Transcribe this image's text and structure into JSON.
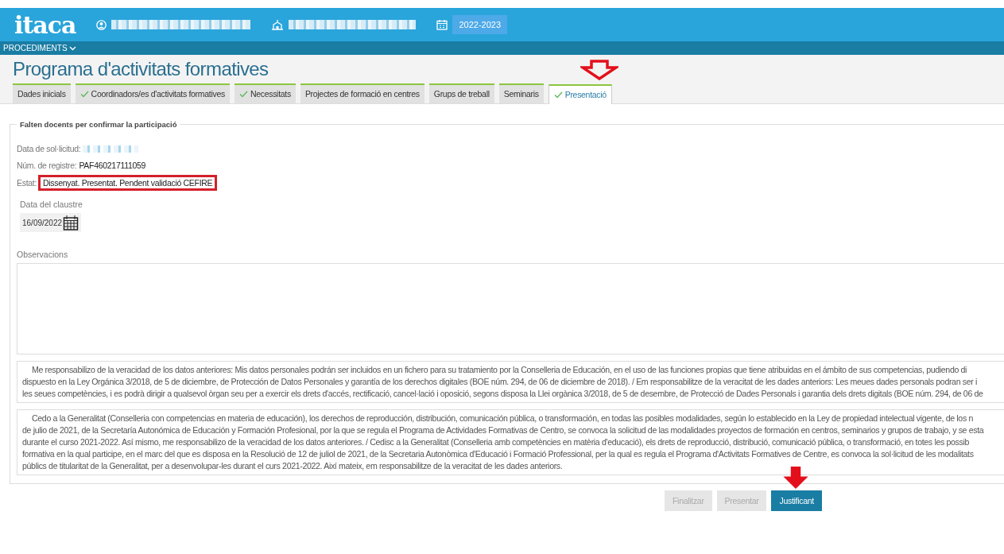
{
  "header": {
    "logo": "itaca",
    "school_year": "2022-2023"
  },
  "menu": {
    "label": "PROCEDIMENTS"
  },
  "page_title": "Programa d'activitats formatives",
  "tabs": [
    {
      "label": "Dades inicials",
      "checked": false,
      "selected": false
    },
    {
      "label": "Coordinadors/es d'activitats formatives",
      "checked": true,
      "selected": false
    },
    {
      "label": "Necessitats",
      "checked": true,
      "selected": false
    },
    {
      "label": "Projectes de formació en centres",
      "checked": false,
      "selected": false
    },
    {
      "label": "Grups de treball",
      "checked": false,
      "selected": false
    },
    {
      "label": "Seminaris",
      "checked": false,
      "selected": false
    },
    {
      "label": "Presentació",
      "checked": true,
      "selected": true
    }
  ],
  "fieldset_legend": "Falten docents per confirmar la participació",
  "fields": [
    {
      "label": "Data de sol·licitud:",
      "kind": "redacted"
    },
    {
      "label": "Núm. de registre:",
      "value": "PAF460217111059",
      "kind": "plain"
    },
    {
      "label": "Estat:",
      "value": "Dissenyat. Presentat. Pendent validació CEFIRE",
      "kind": "highlighted"
    }
  ],
  "claustre_date": {
    "label": "Data del claustre",
    "value": "16/09/2022"
  },
  "observations": {
    "label": "Observacions"
  },
  "disclaimers": [
    [
      "Me responsabilizo de la veracidad de los datos anteriores: Mis datos personales podrán ser incluidos en un fichero para su tratamiento por la Conselleria de Educación, en el uso de las funciones propias que tiene atribuidas en el ámbito de sus competencias, pudiendo di",
      "dispuesto en la Ley Orgánica 3/2018, de 5 de diciembre, de Protección de Datos Personales y garantía de los derechos digitales (BOE núm. 294, de 06 de diciembre de 2018). / Em responsabilitze de la veracitat de les dades anteriors: Les meues dades personals podran ser i",
      "les seues competències, i es podrà dirigir a qualsevol òrgan seu per a exercir els drets d'accés, rectificació, cancel·lació i oposició, segons disposa la Llei orgànica 3/2018, de 5 de desembre, de Protecció de Dades Personals i garantia dels drets digitals (BOE núm. 294, de 06 de"
    ],
    [
      "Cedo a la Generalitat (Conselleria con competencias en materia de educación), los derechos de reproducción, distribución, comunicación pública, o transformación, en todas las posibles modalidades, según lo establecido en la Ley de propiedad intelectual vigente, de los n",
      "de julio de 2021, de la Secretaría Autonómica de Educación y Formación Profesional, por la que se regula el Programa de Actividades Formativas de Centro, se convoca la solicitud de las modalidades proyectos de formación en centros, seminarios y grupos de trabajo, y se esta",
      "durante el curso 2021-2022. Así mismo, me responsabilizo de la veracidad de los datos anteriores. / Cedisc a la Generalitat (Conselleria amb competències en matèria d'educació), els drets de reproducció, distribució, comunicació pública, o transformació, en totes les possib",
      "formativa en la qual participe, en el marc del que es disposa en la Resolució de 12 de juliol de 2021, de la Secretaria Autonòmica d'Educació i Formació Professional, per la qual es regula el Programa d'Activitats Formatives de Centre, es convoca la sol·licitud de les modalitats",
      "públics de titularitat de la Generalitat, per a desenvolupar-les durant el curs 2021-2022. Així mateix, em responsabilitze de la veracitat de les dades anteriors."
    ]
  ],
  "buttons": [
    {
      "label": "Finalitzar",
      "disabled": true
    },
    {
      "label": "Presentar",
      "disabled": true
    },
    {
      "label": "Justificant",
      "disabled": false
    }
  ]
}
